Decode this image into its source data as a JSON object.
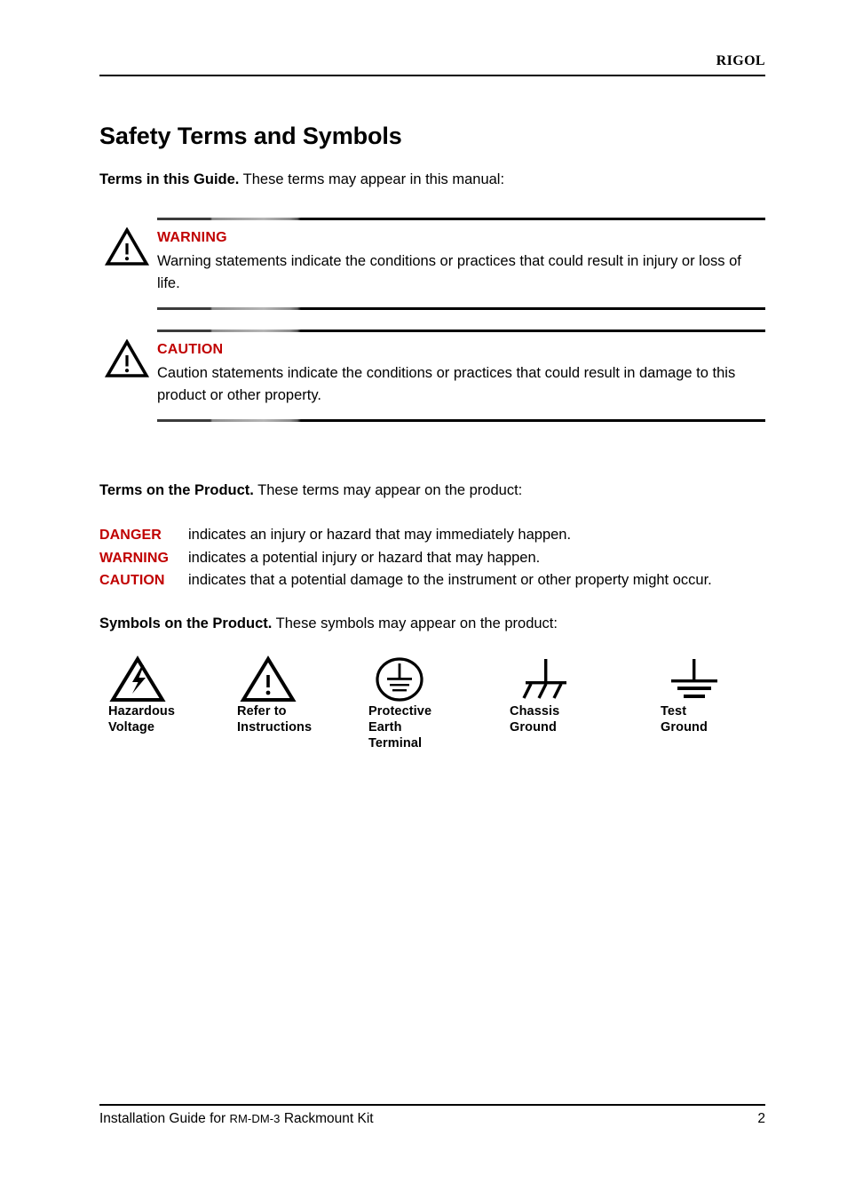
{
  "colors": {
    "alert_red": "#C00000",
    "text": "#000000",
    "rule": "#000000"
  },
  "header": {
    "brand": "RIGOL"
  },
  "page_title": "Safety Terms and Symbols",
  "terms_in_guide": {
    "intro_bold": "Terms in this Guide.",
    "intro_rest": " These terms may appear in this manual:",
    "items": [
      {
        "label": "WARNING",
        "icon": "warning-triangle-icon",
        "description": "Warning statements indicate the conditions or practices that could result in injury or loss of life."
      },
      {
        "label": "CAUTION",
        "icon": "warning-triangle-icon",
        "description": "Caution statements indicate the conditions or practices that could result in damage to this product or other property."
      }
    ]
  },
  "terms_on_product": {
    "intro_bold": "Terms on the Product.",
    "intro_rest": " These terms may appear on the product:",
    "rows": [
      {
        "term": "DANGER",
        "meaning": "indicates an injury or hazard that may immediately happen."
      },
      {
        "term": "WARNING",
        "meaning": "indicates a potential injury or hazard that may happen."
      },
      {
        "term": "CAUTION",
        "meaning": "indicates that a potential damage to the instrument or other property might occur."
      }
    ]
  },
  "symbols_on_product": {
    "intro_bold": "Symbols on the Product.",
    "intro_rest": " These symbols may appear on the product:",
    "symbols": [
      {
        "icon": "hazardous-voltage-icon",
        "label": "Hazardous\nVoltage"
      },
      {
        "icon": "refer-to-instructions-icon",
        "label": "Refer to\nInstructions"
      },
      {
        "icon": "protective-earth-terminal-icon",
        "label": "Protective\nEarth\nTerminal"
      },
      {
        "icon": "chassis-ground-icon",
        "label": "Chassis\nGround"
      },
      {
        "icon": "test-ground-icon",
        "label": "Test\nGround"
      }
    ]
  },
  "footer": {
    "doc_prefix": "Installation Guide for ",
    "doc_model": "RM-DM-3",
    "doc_suffix": " Rackmount Kit",
    "page_number": "2"
  }
}
